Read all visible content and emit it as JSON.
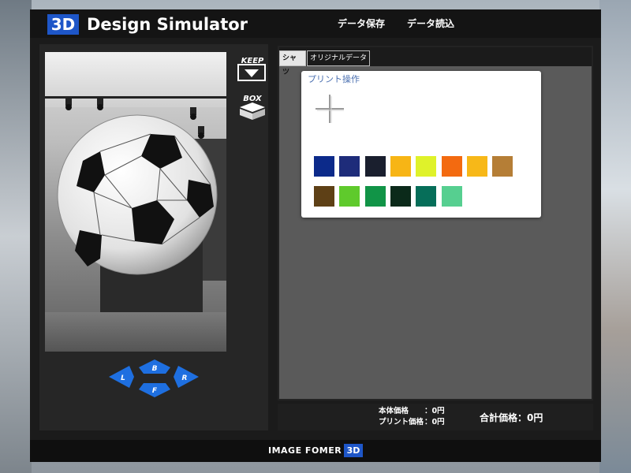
{
  "header": {
    "logo_badge": "3D",
    "title": "Design Simulator",
    "nav": {
      "save": "データ保存",
      "load": "データ読込"
    }
  },
  "side_icons": {
    "keep": "KEEP",
    "box": "BOX"
  },
  "direction_pad": {
    "back": "B",
    "front": "F",
    "left": "L",
    "right": "R",
    "color": "#1e6fe0"
  },
  "tabs": [
    {
      "label": "シャツ",
      "active": true
    },
    {
      "label": "オリジナルデータ",
      "active": false
    }
  ],
  "print_panel": {
    "title": "プリント操作",
    "swatches_row1": [
      "#0c2a8a",
      "#1e2c7a",
      "#1a1f2e",
      "#f7b515",
      "#dff22a",
      "#f36a10",
      "#f7b818",
      "#b57e36"
    ],
    "swatches_row2": [
      "#5e4016",
      "#5fca2c",
      "#119447",
      "#0b2a1a",
      "#066e59",
      "#56cf90"
    ]
  },
  "prices": {
    "body_label": "本体価格",
    "body_value": "：0円",
    "print_label": "プリント価格",
    "print_value": "：0円",
    "total": "合計価格：0円"
  },
  "footer": {
    "brand": "IMAGE FOMER",
    "badge": "3D"
  }
}
